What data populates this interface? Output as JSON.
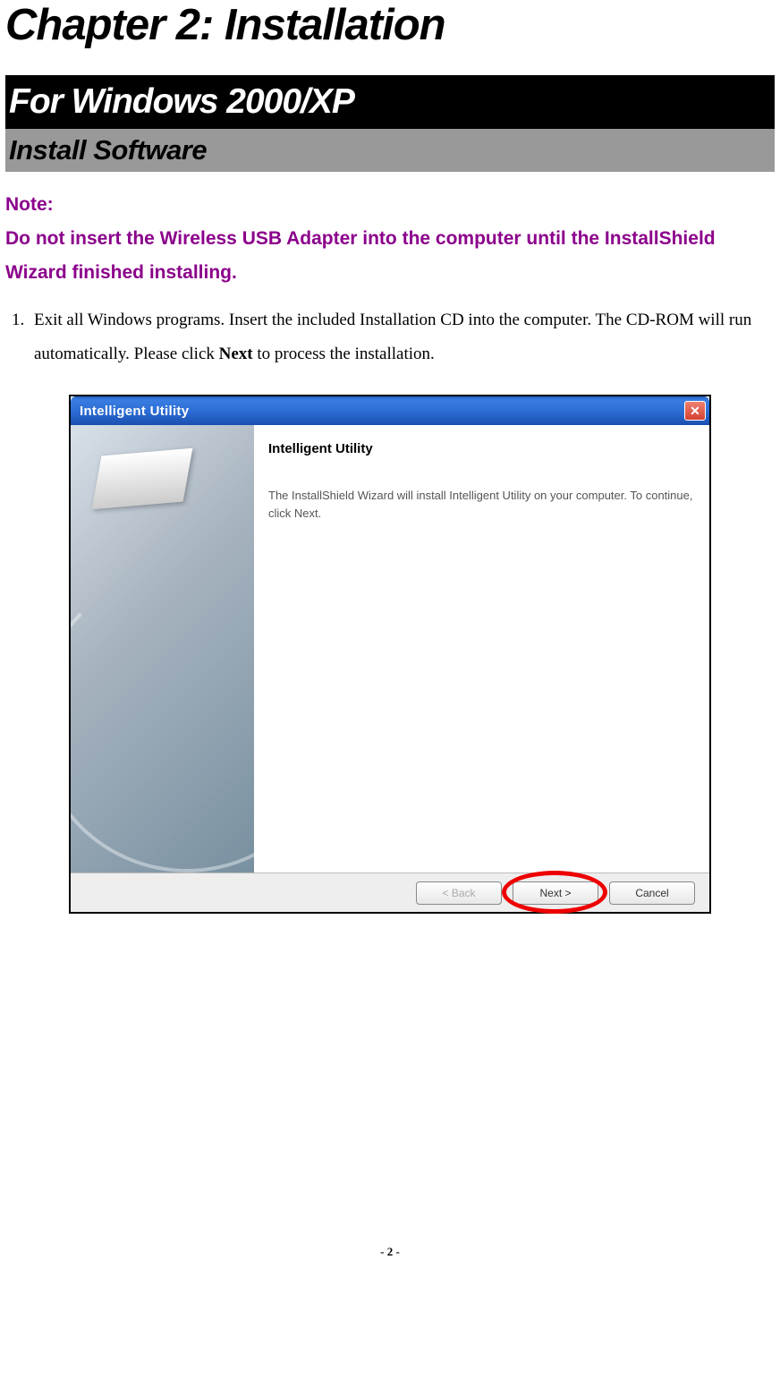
{
  "chapter": {
    "title": "Chapter 2: Installation"
  },
  "section_black": "For Windows 2000/XP",
  "section_gray": "Install Software",
  "note": {
    "label": "Note:",
    "text": "Do not insert the Wireless USB Adapter into the computer until the InstallShield Wizard finished installing."
  },
  "step1": {
    "number": "1.",
    "text_before_bold": "Exit all Windows programs. Insert the included Installation CD into the computer. The CD-ROM will run automatically. Please click ",
    "bold_word": "Next",
    "text_after_bold": " to process the installation."
  },
  "dialog": {
    "titlebar": "Intelligent Utility",
    "close_symbol": "✕",
    "content_title": "Intelligent Utility",
    "content_text": "The InstallShield Wizard will install Intelligent Utility on your computer.  To continue, click Next.",
    "buttons": {
      "back": "< Back",
      "next": "Next >",
      "cancel": "Cancel"
    }
  },
  "footer": "- 2 -"
}
